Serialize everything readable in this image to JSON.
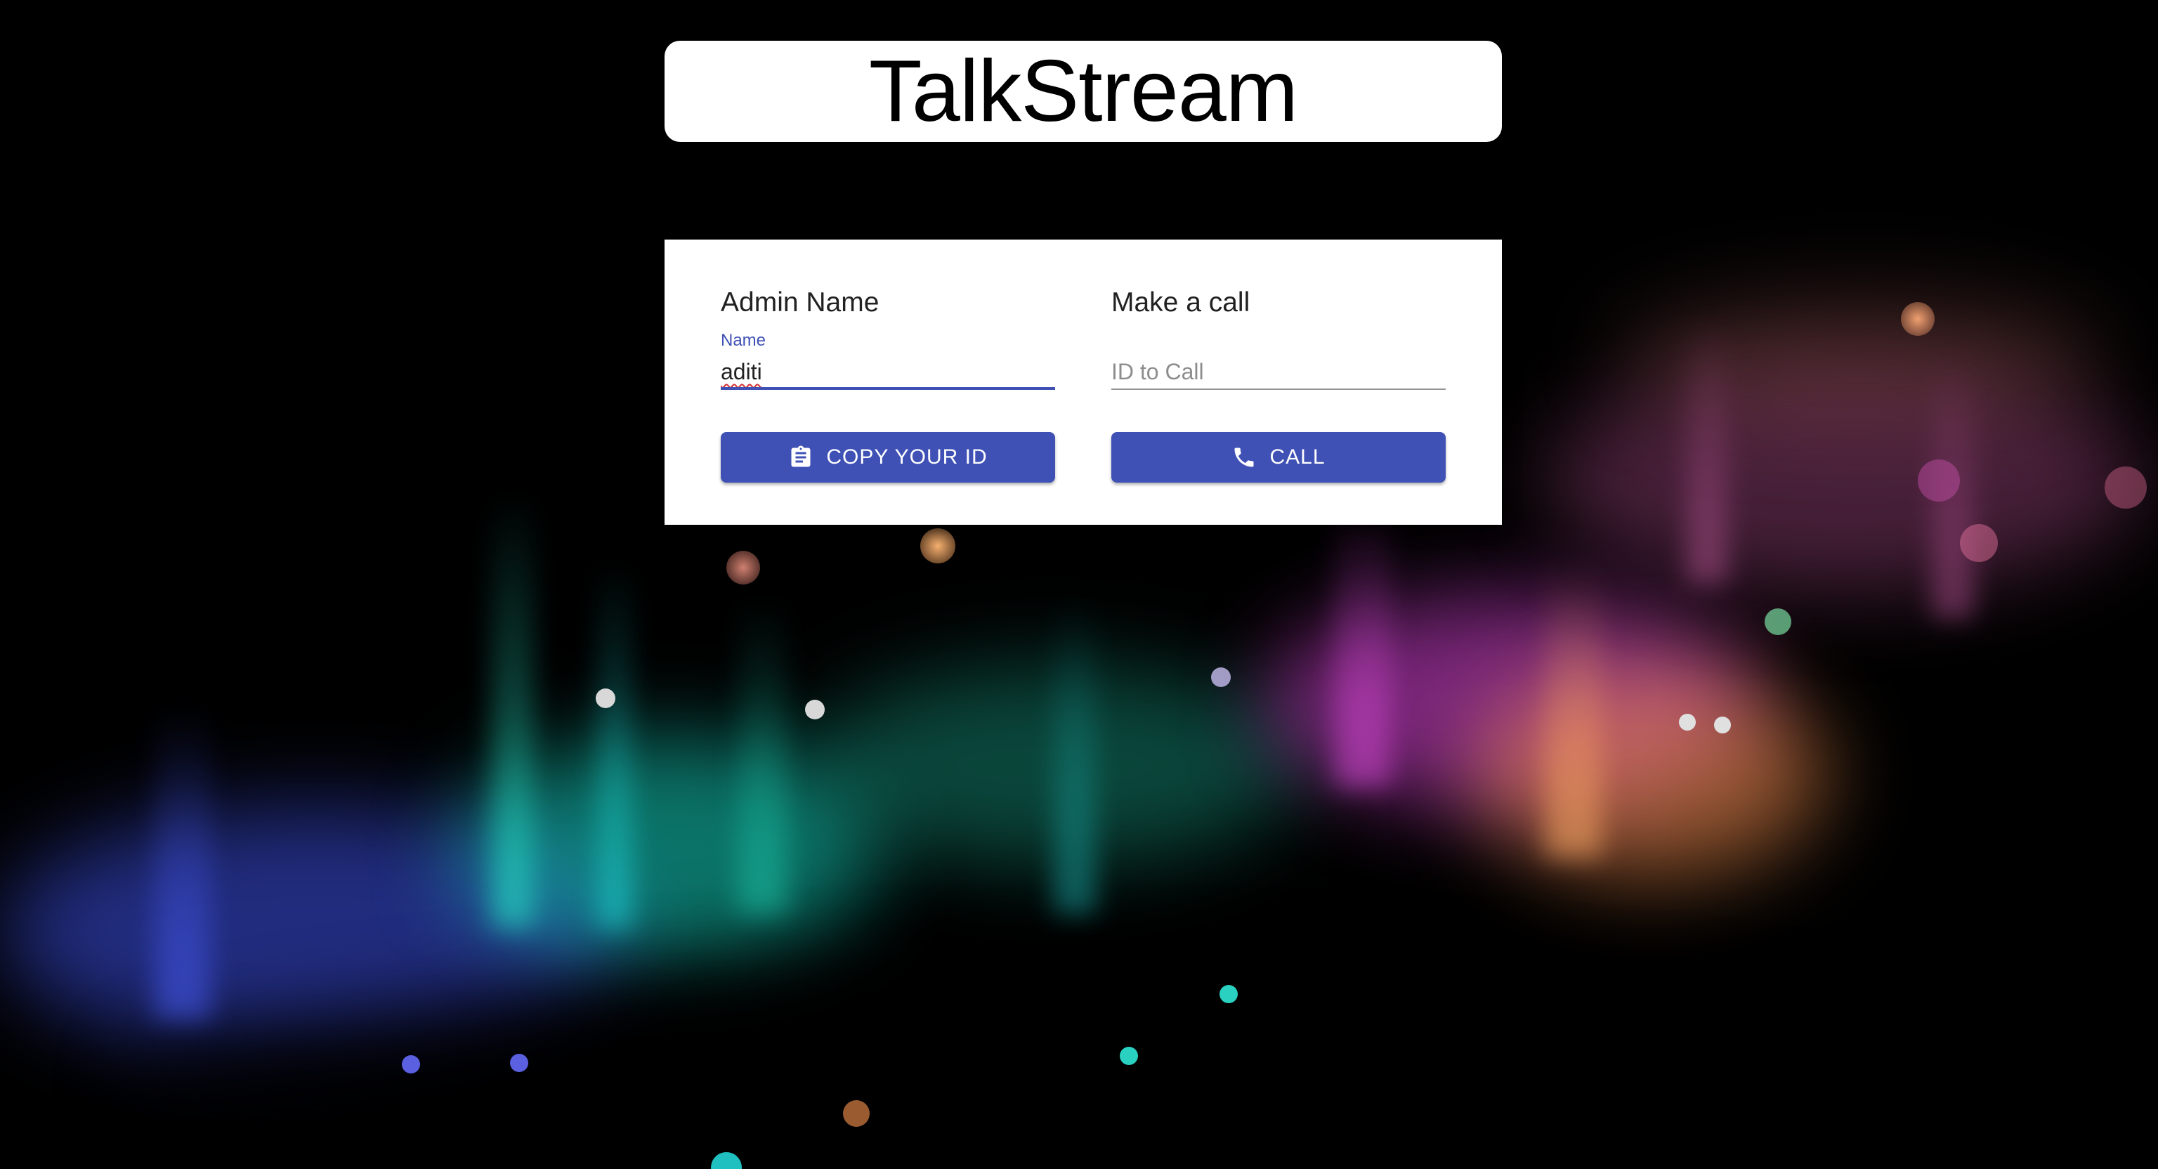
{
  "app": {
    "title": "TalkStream"
  },
  "admin": {
    "heading": "Admin Name",
    "name_label": "Name",
    "name_value": "aditi",
    "copy_button_label": "COPY YOUR ID",
    "copy_icon": "clipboard-icon"
  },
  "call": {
    "heading": "Make a call",
    "id_placeholder": "ID to Call",
    "call_button_label": "CALL",
    "call_icon": "phone-icon"
  },
  "colors": {
    "accent": "#3f51b5",
    "background": "#000000",
    "card": "#ffffff"
  }
}
